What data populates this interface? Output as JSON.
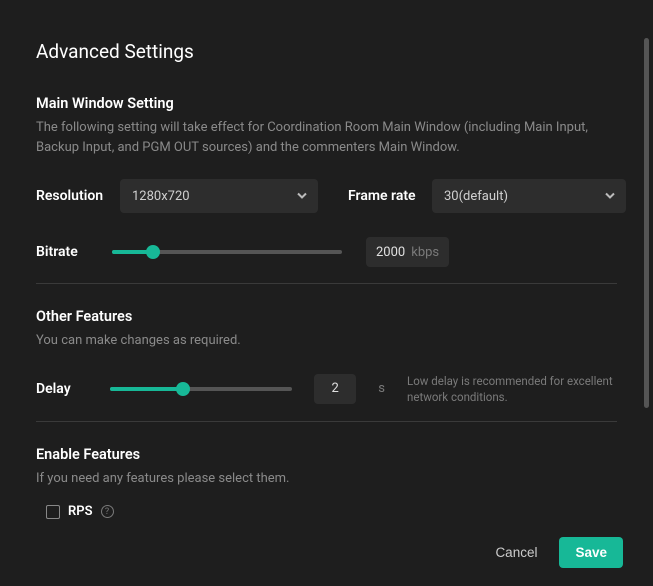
{
  "title": "Advanced Settings",
  "mainWindow": {
    "heading": "Main Window Setting",
    "description": "The following setting will take effect for Coordination Room Main Window (including Main Input, Backup Input, and PGM OUT sources) and the commenters Main Window.",
    "resolution": {
      "label": "Resolution",
      "value": "1280x720"
    },
    "frameRate": {
      "label": "Frame rate",
      "value": "30(default)"
    },
    "bitrate": {
      "label": "Bitrate",
      "value": "2000",
      "unit": "kbps",
      "sliderPercent": 18
    }
  },
  "otherFeatures": {
    "heading": "Other Features",
    "description": "You can make changes as required.",
    "delay": {
      "label": "Delay",
      "value": "2",
      "unit": "s",
      "hint": "Low delay is recommended for excellent network conditions.",
      "sliderPercent": 40
    }
  },
  "enableFeatures": {
    "heading": "Enable Features",
    "description": "If you need any features please select them.",
    "rps": {
      "label": "RPS",
      "checked": false
    }
  },
  "footer": {
    "cancel": "Cancel",
    "save": "Save"
  }
}
